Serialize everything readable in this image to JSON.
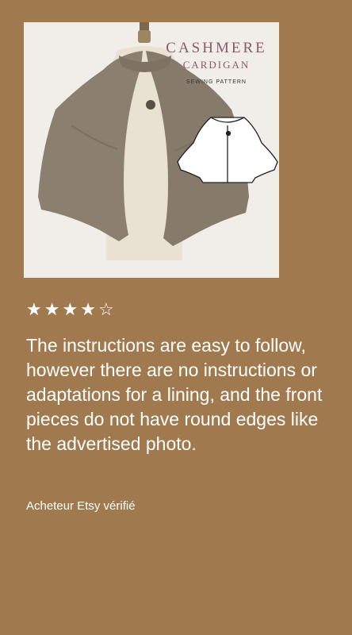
{
  "product_image": {
    "title_line1": "CASHMERE",
    "title_line2": "CARDIGAN",
    "subtitle": "SEWING PATTERN",
    "icon": "cardigan-photo"
  },
  "rating": {
    "value": 4,
    "max": 5,
    "filled_star": "★",
    "empty_star": "☆"
  },
  "review": {
    "text": "The instructions are easy to follow, however there are no instructions or adaptations for a lining, and the front pieces do not have round edges like the advertised photo.",
    "author": "Acheteur Etsy vérifié"
  },
  "colors": {
    "background": "#a07a4e",
    "text": "#ffffff"
  }
}
